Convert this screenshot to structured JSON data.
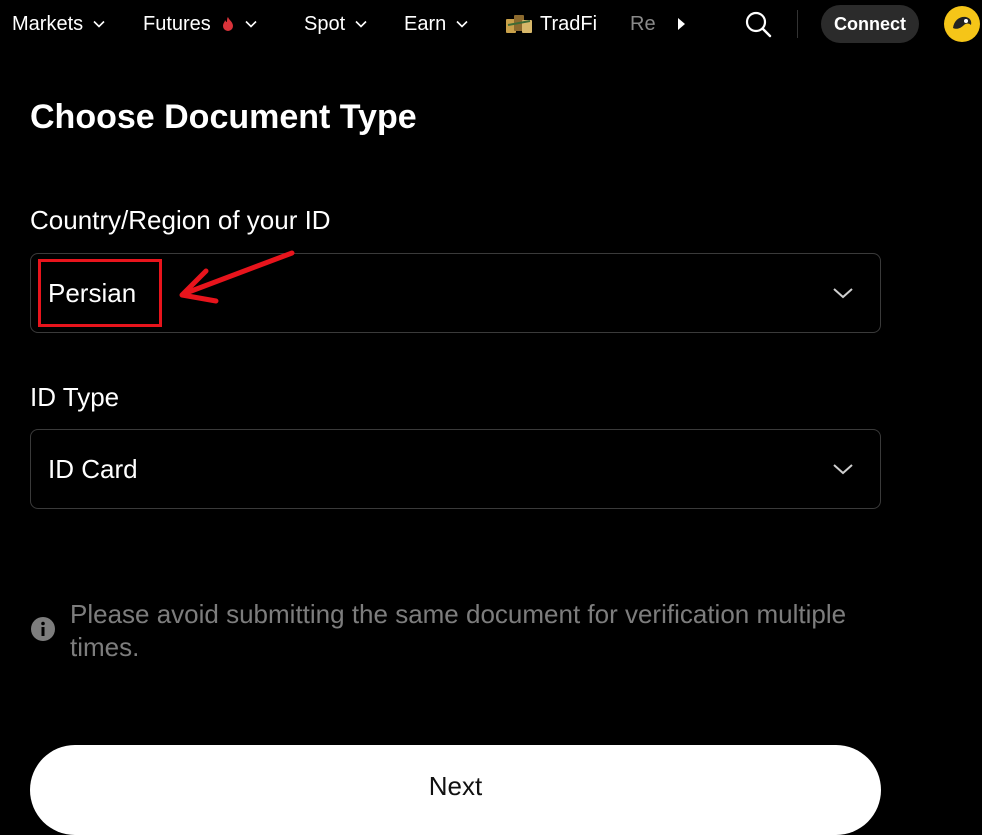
{
  "nav": {
    "items": [
      {
        "label": "Markets"
      },
      {
        "label": "Futures"
      },
      {
        "label": "Spot"
      },
      {
        "label": "Earn"
      },
      {
        "label": "TradFi"
      },
      {
        "label": "Re"
      }
    ],
    "connect_label": "Connect"
  },
  "page": {
    "title": "Choose Document Type"
  },
  "country_field": {
    "label": "Country/Region of your ID",
    "value": "Persian"
  },
  "id_type_field": {
    "label": "ID Type",
    "value": "ID Card"
  },
  "notice": {
    "text": "Please avoid submitting the same document for verification multiple times."
  },
  "next_label": "Next",
  "colors": {
    "background": "#000000",
    "annotation": "#e8141c",
    "muted_text": "#7d7d7d",
    "avatar": "#f5c518"
  }
}
